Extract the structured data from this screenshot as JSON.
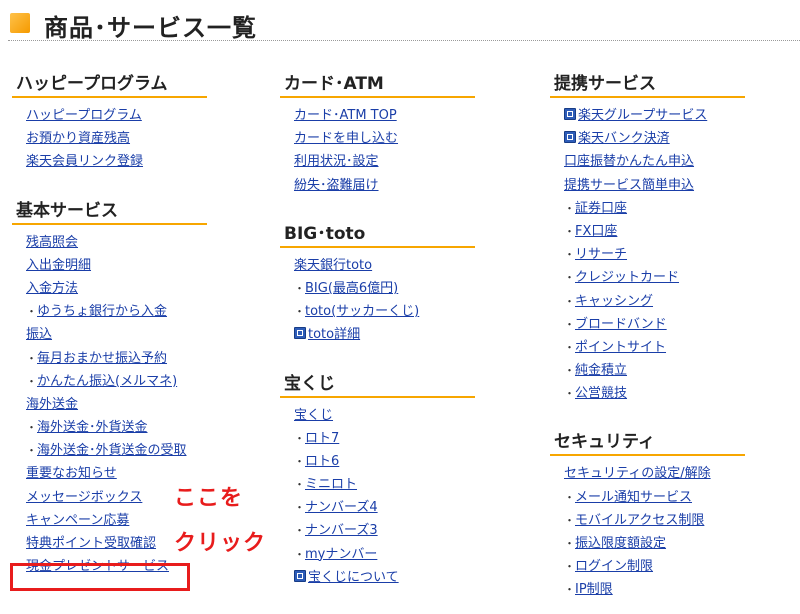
{
  "header": {
    "title": "商品･サービス一覧"
  },
  "annotation": {
    "line1": "ここを",
    "line2": "クリック"
  },
  "columns": [
    {
      "sections": [
        {
          "title": "ハッピープログラム",
          "items": [
            {
              "label": "ハッピープログラム",
              "level": 1
            },
            {
              "label": "お預かり資産残高",
              "level": 1
            },
            {
              "label": "楽天会員リンク登録",
              "level": 1
            }
          ]
        },
        {
          "title": "基本サービス",
          "items": [
            {
              "label": "残高照会",
              "level": 1
            },
            {
              "label": "入出金明細",
              "level": 1
            },
            {
              "label": "入金方法",
              "level": 1
            },
            {
              "label": "ゆうちょ銀行から入金",
              "level": 2
            },
            {
              "label": "振込",
              "level": 1
            },
            {
              "label": "毎月おまかせ振込予約",
              "level": 2
            },
            {
              "label": "かんたん振込(メルマネ)",
              "level": 2
            },
            {
              "label": "海外送金",
              "level": 1
            },
            {
              "label": "海外送金･外貨送金",
              "level": 2
            },
            {
              "label": "海外送金･外貨送金の受取",
              "level": 2
            },
            {
              "label": "重要なお知らせ",
              "level": 1
            },
            {
              "label": "メッセージボックス",
              "level": 1
            },
            {
              "label": "キャンペーン応募",
              "level": 1
            },
            {
              "label": "特典ポイント受取確認",
              "level": 1
            },
            {
              "label": "現金プレゼントサービス",
              "level": 1
            }
          ]
        }
      ]
    },
    {
      "sections": [
        {
          "title": "カード･ATM",
          "items": [
            {
              "label": "カード･ATM TOP",
              "level": 1
            },
            {
              "label": "カードを申し込む",
              "level": 1
            },
            {
              "label": "利用状況･設定",
              "level": 1
            },
            {
              "label": "紛失･盗難届け",
              "level": 1
            }
          ]
        },
        {
          "title": "BIG･toto",
          "items": [
            {
              "label": "楽天銀行toto",
              "level": 1
            },
            {
              "label": "BIG(最高6億円)",
              "level": 2
            },
            {
              "label": "toto(サッカーくじ)",
              "level": 2
            },
            {
              "label": "toto詳細",
              "level": 1,
              "ext": true
            }
          ]
        },
        {
          "title": "宝くじ",
          "items": [
            {
              "label": "宝くじ",
              "level": 1
            },
            {
              "label": "ロト7",
              "level": 2
            },
            {
              "label": "ロト6",
              "level": 2
            },
            {
              "label": "ミニロト",
              "level": 2
            },
            {
              "label": "ナンバーズ4",
              "level": 2
            },
            {
              "label": "ナンバーズ3",
              "level": 2
            },
            {
              "label": "myナンバー",
              "level": 2
            },
            {
              "label": "宝くじについて",
              "level": 1,
              "ext": true
            }
          ]
        }
      ]
    },
    {
      "sections": [
        {
          "title": "提携サービス",
          "items": [
            {
              "label": "楽天グループサービス",
              "level": 1,
              "ext": true
            },
            {
              "label": "楽天バンク決済",
              "level": 1,
              "ext": true
            },
            {
              "label": "口座振替かんたん申込",
              "level": 1
            },
            {
              "label": "提携サービス簡単申込",
              "level": 1
            },
            {
              "label": "証券口座",
              "level": 2
            },
            {
              "label": "FX口座",
              "level": 2
            },
            {
              "label": "リサーチ",
              "level": 2
            },
            {
              "label": "クレジットカード",
              "level": 2
            },
            {
              "label": "キャッシング",
              "level": 2
            },
            {
              "label": "ブロードバンド",
              "level": 2
            },
            {
              "label": "ポイントサイト",
              "level": 2
            },
            {
              "label": "純金積立",
              "level": 2
            },
            {
              "label": "公営競技",
              "level": 2
            }
          ]
        },
        {
          "title": "セキュリティ",
          "items": [
            {
              "label": "セキュリティの設定/解除",
              "level": 1
            },
            {
              "label": "メール通知サービス",
              "level": 2
            },
            {
              "label": "モバイルアクセス制限",
              "level": 2
            },
            {
              "label": "振込限度額設定",
              "level": 2
            },
            {
              "label": "ログイン制限",
              "level": 2
            },
            {
              "label": "IP制限",
              "level": 2
            }
          ]
        }
      ]
    }
  ]
}
